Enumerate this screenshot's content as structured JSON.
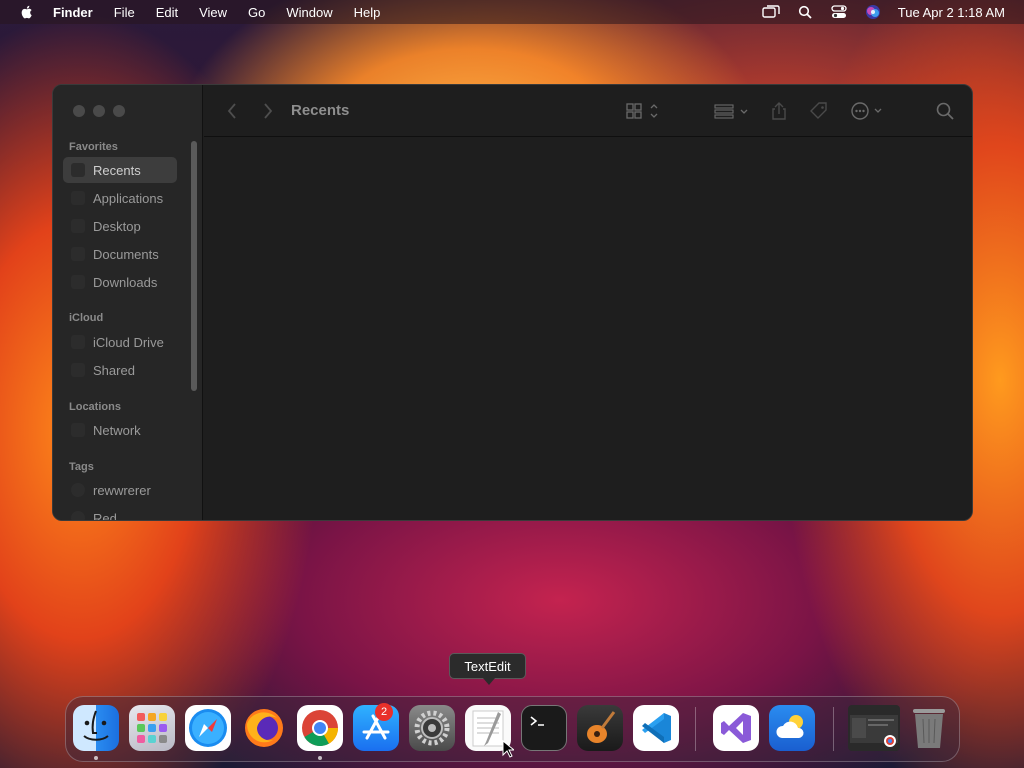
{
  "menubar": {
    "app_name": "Finder",
    "items": [
      "File",
      "Edit",
      "View",
      "Go",
      "Window",
      "Help"
    ],
    "clock": "Tue Apr 2  1:18 AM"
  },
  "finder": {
    "title": "Recents",
    "sidebar": {
      "sections": [
        {
          "label": "Favorites",
          "items": [
            "Recents",
            "Applications",
            "Desktop",
            "Documents",
            "Downloads"
          ]
        },
        {
          "label": "iCloud",
          "items": [
            "iCloud Drive",
            "Shared"
          ]
        },
        {
          "label": "Locations",
          "items": [
            "Network"
          ]
        },
        {
          "label": "Tags",
          "items": [
            "rewwrerer",
            "Red"
          ]
        }
      ],
      "selected": "Recents"
    }
  },
  "dock": {
    "tooltip": "TextEdit",
    "apps": [
      "Finder",
      "Launchpad",
      "Safari",
      "Firefox",
      "Chrome",
      "App Store",
      "System Settings",
      "TextEdit",
      "Terminal",
      "GarageBand",
      "Visual Studio Code",
      "Visual Studio",
      "Weather",
      "Recent Window",
      "Trash"
    ],
    "settings_badge": "2"
  }
}
